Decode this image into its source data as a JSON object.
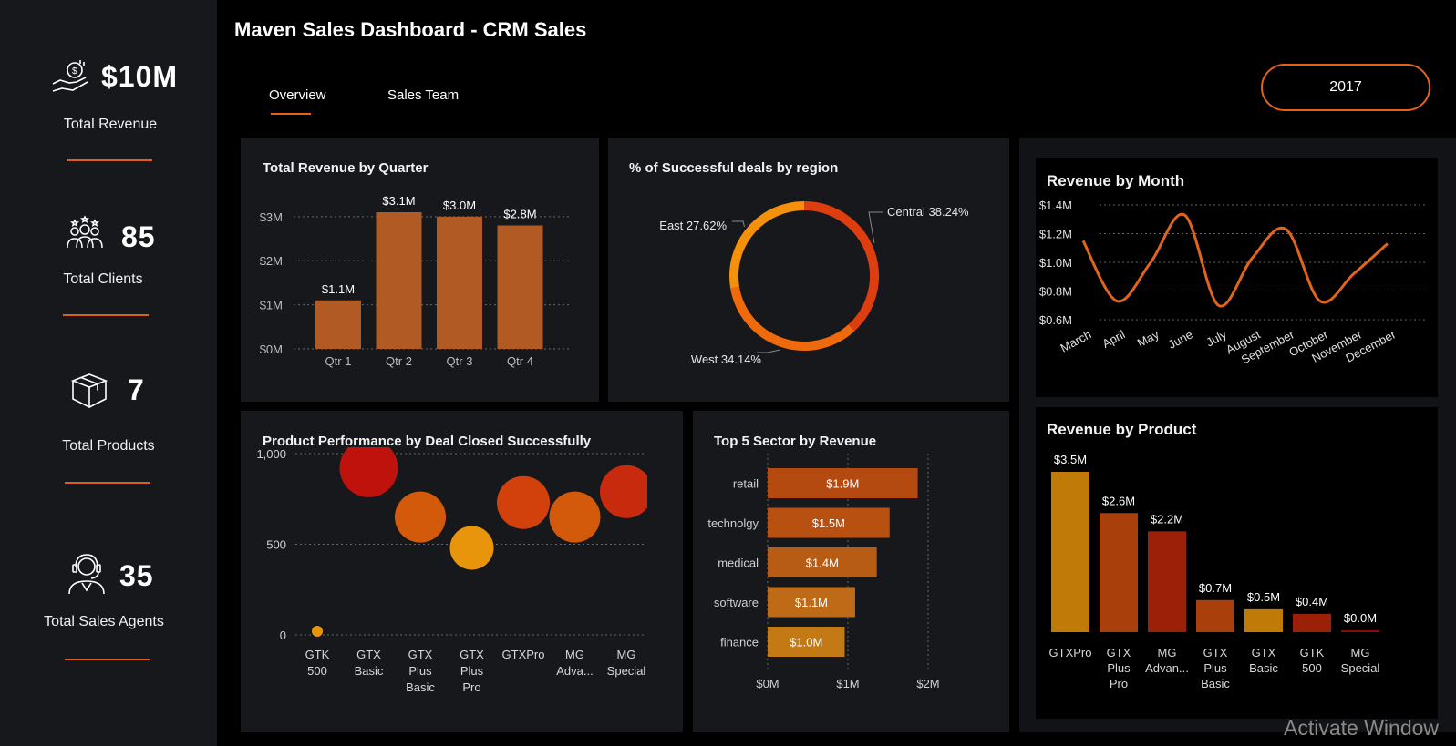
{
  "header": {
    "title": "Maven Sales Dashboard - CRM Sales",
    "tabs": [
      {
        "label": "Overview",
        "active": true
      },
      {
        "label": "Sales Team",
        "active": false
      }
    ],
    "year_button": "2017"
  },
  "sidebar": {
    "kpis": [
      {
        "value": "$10M",
        "label": "Total Revenue",
        "icon": "money-hand-icon"
      },
      {
        "value": "85",
        "label": "Total Clients",
        "icon": "clients-icon"
      },
      {
        "value": "7",
        "label": "Total Products",
        "icon": "box-icon"
      },
      {
        "value": "35",
        "label": "Total Sales Agents",
        "icon": "headset-agent-icon"
      }
    ]
  },
  "colors": {
    "accent": "#e0641c",
    "bar": "#b25a24",
    "background": "#000000",
    "panel": "#16181c"
  },
  "watermark": "Activate Window",
  "chart_data": [
    {
      "id": "quarter",
      "type": "bar",
      "title": "Total Revenue by Quarter",
      "categories": [
        "Qtr 1",
        "Qtr 2",
        "Qtr 3",
        "Qtr 4"
      ],
      "values": [
        1.1,
        3.1,
        3.0,
        2.8
      ],
      "data_labels": [
        "$1.1M",
        "$3.1M",
        "$3.0M",
        "$2.8M"
      ],
      "yticks": [
        {
          "v": 0,
          "label": "$0M"
        },
        {
          "v": 1,
          "label": "$1M"
        },
        {
          "v": 2,
          "label": "$2M"
        },
        {
          "v": 3,
          "label": "$3M"
        }
      ],
      "ylim": [
        0,
        3.1
      ]
    },
    {
      "id": "region",
      "type": "pie",
      "title": "% of Successful deals by region",
      "slices": [
        {
          "label": "Central 38.24%",
          "value": 38.24,
          "color": "#de3d10"
        },
        {
          "label": "West 34.14%",
          "value": 34.14,
          "color": "#ef6a0c"
        },
        {
          "label": "East 27.62%",
          "value": 27.62,
          "color": "#f4900a"
        }
      ]
    },
    {
      "id": "month",
      "type": "line",
      "title": "Revenue by Month",
      "categories": [
        "March",
        "April",
        "May",
        "June",
        "July",
        "August",
        "September",
        "October",
        "November",
        "December"
      ],
      "values": [
        1.15,
        0.73,
        1.0,
        1.33,
        0.7,
        1.03,
        1.23,
        0.73,
        0.92,
        1.13
      ],
      "yticks": [
        {
          "v": 0.6,
          "label": "$0.6M"
        },
        {
          "v": 0.8,
          "label": "$0.8M"
        },
        {
          "v": 1.0,
          "label": "$1.0M"
        },
        {
          "v": 1.2,
          "label": "$1.2M"
        },
        {
          "v": 1.4,
          "label": "$1.4M"
        }
      ],
      "ylim": [
        0.6,
        1.4
      ]
    },
    {
      "id": "product_perf",
      "type": "scatter",
      "title": "Product Performance by Deal Closed Successfully",
      "categories": [
        "GTK 500",
        "GTX Basic",
        "GTX Plus Basic",
        "GTX Plus Pro",
        "GTXPro",
        "MG Adva...",
        "MG Special"
      ],
      "values": [
        20,
        920,
        650,
        480,
        730,
        650,
        790
      ],
      "sizes": [
        6,
        32,
        28,
        24,
        29,
        28,
        29
      ],
      "colors": [
        "#e8950c",
        "#c0120c",
        "#d45a0b",
        "#e8950c",
        "#d2400c",
        "#d45a0b",
        "#c72a0c"
      ],
      "yticks": [
        {
          "v": 0,
          "label": "0"
        },
        {
          "v": 500,
          "label": "500"
        },
        {
          "v": 1000,
          "label": "1,000"
        }
      ],
      "ylim": [
        0,
        1000
      ]
    },
    {
      "id": "sector",
      "type": "bar",
      "orientation": "horizontal",
      "title": "Top 5 Sector by Revenue",
      "categories": [
        "retail",
        "technolgy",
        "medical",
        "software",
        "finance"
      ],
      "values": [
        1.87,
        1.52,
        1.36,
        1.09,
        0.96
      ],
      "data_labels": [
        "$1.9M",
        "$1.5M",
        "$1.4M",
        "$1.1M",
        "$1.0M"
      ],
      "colors": [
        "#b44a10",
        "#b85012",
        "#b75c14",
        "#bf6a16",
        "#c47a14"
      ],
      "xticks": [
        {
          "v": 0,
          "label": "$0M"
        },
        {
          "v": 1,
          "label": "$1M"
        },
        {
          "v": 2,
          "label": "$2M"
        }
      ],
      "xlim": [
        0,
        2
      ]
    },
    {
      "id": "product_rev",
      "type": "bar",
      "title": "Revenue by Product",
      "categories": [
        "GTXPro",
        "GTX Plus Pro",
        "MG Advan...",
        "GTX Plus Basic",
        "GTX Basic",
        "GTK 500",
        "MG Special"
      ],
      "values": [
        3.5,
        2.6,
        2.2,
        0.7,
        0.5,
        0.4,
        0.04
      ],
      "data_labels": [
        "$3.5M",
        "$2.6M",
        "$2.2M",
        "$0.7M",
        "$0.5M",
        "$0.4M",
        "$0.0M"
      ],
      "colors": [
        "#c07a08",
        "#a9400c",
        "#9c2008",
        "#a9400c",
        "#c07a08",
        "#9c2008",
        "#8a0a0a"
      ],
      "ylim": [
        0,
        3.5
      ]
    }
  ]
}
